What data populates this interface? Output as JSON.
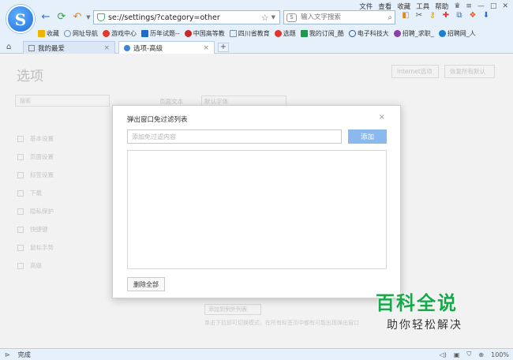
{
  "menu": {
    "file": "文件",
    "view": "查看",
    "favorites": "收藏",
    "tools": "工具",
    "help": "帮助"
  },
  "address": {
    "url": "se://settings/?category=other"
  },
  "search": {
    "placeholder": "输入文字搜索"
  },
  "bookmarks": [
    {
      "label": "收藏",
      "color": "#f0b400"
    },
    {
      "label": "网址导航",
      "color": "#6b8fb5"
    },
    {
      "label": "游戏中心",
      "color": "#e33a2b"
    },
    {
      "label": "历年试题--",
      "color": "#1a6bcb"
    },
    {
      "label": "中国高等教",
      "color": "#c8282c"
    },
    {
      "label": "四川省教育",
      "color": "#7a8da6"
    },
    {
      "label": "选题",
      "color": "#e3342b"
    },
    {
      "label": "我的订阅_酷",
      "color": "#1c9a4a"
    },
    {
      "label": "电子科技大",
      "color": "#2b4f9e"
    },
    {
      "label": "招聘_求职_",
      "color": "#8c3fa8"
    },
    {
      "label": "招聘网_人",
      "color": "#1b7fd1"
    }
  ],
  "tabs": [
    {
      "label": "我的最爱"
    },
    {
      "label": "选项-高级"
    }
  ],
  "settings_page": {
    "title": "选项",
    "top_button_1": "Internet选项",
    "top_button_2": "恢复所有默认",
    "search_placeholder": "搜索",
    "line_label": "页面文本",
    "line_value": "默认字体",
    "sidebar": [
      "基本设置",
      "页面设置",
      "标签设置",
      "下载",
      "隐私保护",
      "快捷键",
      "鼠标手势",
      "高级"
    ],
    "bottom_button": "添加到例外列表",
    "note": "单击下拉即可切换模式，在所有标签页中都有可能出现弹出窗口"
  },
  "modal": {
    "title": "弹出窗口免过滤列表",
    "input_placeholder": "添加免过滤内容",
    "add_label": "添加",
    "delete_all_label": "删除全部",
    "close_label": "×"
  },
  "watermark": {
    "main": "百科全说",
    "sub": "助你轻松解决"
  },
  "status": {
    "text": "完成",
    "zoom": "100%"
  }
}
